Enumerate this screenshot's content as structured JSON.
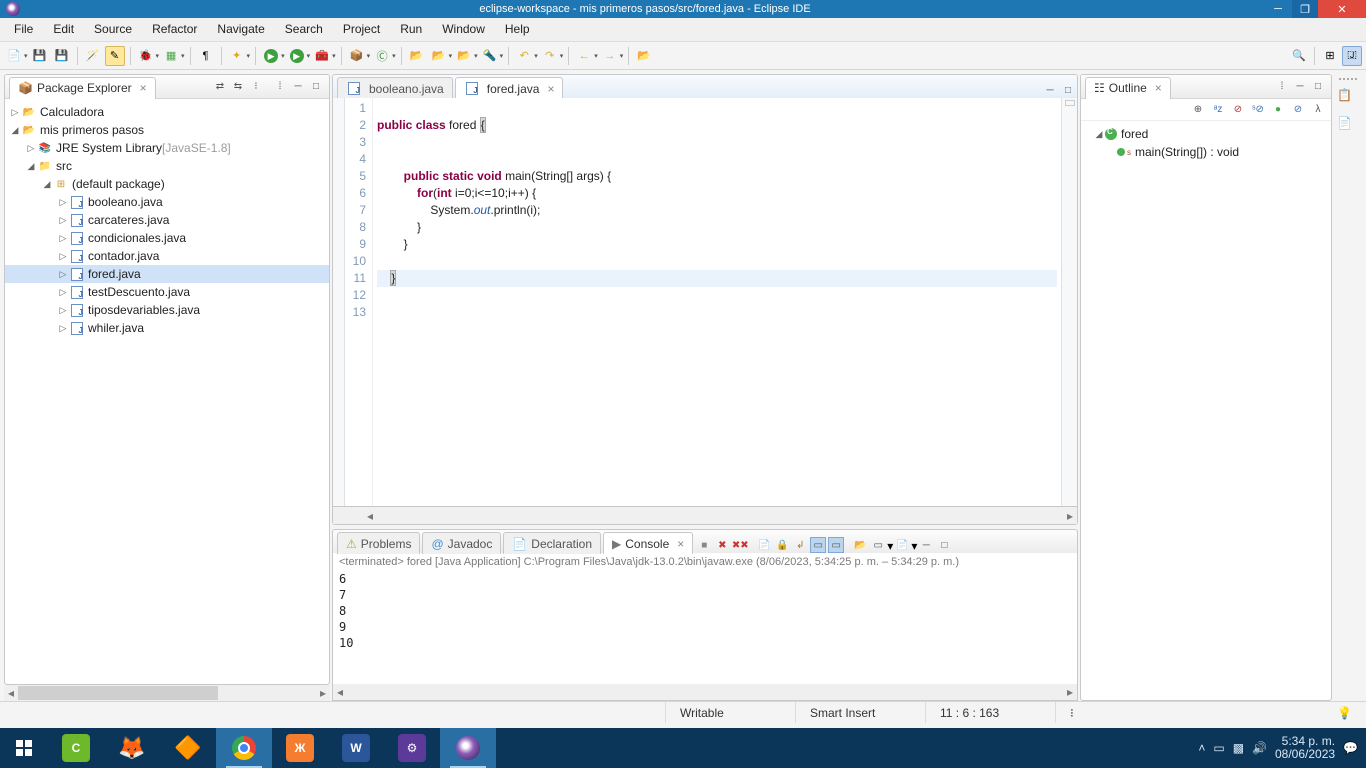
{
  "title": "eclipse-workspace - mis primeros pasos/src/fored.java - Eclipse IDE",
  "menu": [
    "File",
    "Edit",
    "Source",
    "Refactor",
    "Navigate",
    "Search",
    "Project",
    "Run",
    "Window",
    "Help"
  ],
  "pkg_explorer": {
    "title": "Package Explorer",
    "projects": [
      {
        "name": "Calculadora",
        "expanded": false
      },
      {
        "name": "mis primeros pasos",
        "expanded": true,
        "children": [
          {
            "name": "JRE System Library",
            "suffix": "[JavaSE-1.8]",
            "type": "lib"
          },
          {
            "name": "src",
            "type": "srcfolder",
            "expanded": true,
            "children": [
              {
                "name": "(default package)",
                "type": "package",
                "expanded": true,
                "children": [
                  {
                    "name": "booleano.java",
                    "type": "java"
                  },
                  {
                    "name": "carcateres.java",
                    "type": "java"
                  },
                  {
                    "name": "condicionales.java",
                    "type": "java"
                  },
                  {
                    "name": "contador.java",
                    "type": "java"
                  },
                  {
                    "name": "fored.java",
                    "type": "java",
                    "selected": true
                  },
                  {
                    "name": "testDescuento.java",
                    "type": "java"
                  },
                  {
                    "name": "tiposdevariables.java",
                    "type": "java"
                  },
                  {
                    "name": "whiler.java",
                    "type": "java"
                  }
                ]
              }
            ]
          }
        ]
      }
    ]
  },
  "editor": {
    "tabs": [
      {
        "name": "booleano.java",
        "active": false
      },
      {
        "name": "fored.java",
        "active": true
      }
    ],
    "line_count": 13,
    "code_lines": [
      "",
      "public class fored {",
      "",
      "",
      "        public static void main(String[] args) {",
      "            for(int i=0;i<=10;i++) {",
      "                System.out.println(i);",
      "            }",
      "        }",
      "",
      "    }",
      "",
      ""
    ]
  },
  "bottom_tabs": [
    "Problems",
    "Javadoc",
    "Declaration",
    "Console"
  ],
  "console": {
    "info": "<terminated> fored [Java Application] C:\\Program Files\\Java\\jdk-13.0.2\\bin\\javaw.exe  (8/06/2023, 5:34:25 p. m. – 5:34:29 p. m.)",
    "output": "6\n7\n8\n9\n10"
  },
  "outline": {
    "title": "Outline",
    "class": "fored",
    "method": "main(String[]) : void"
  },
  "status": {
    "writable": "Writable",
    "insert": "Smart Insert",
    "pos": "11 : 6 : 163"
  },
  "tray": {
    "time": "5:34 p. m.",
    "date": "08/06/2023"
  }
}
